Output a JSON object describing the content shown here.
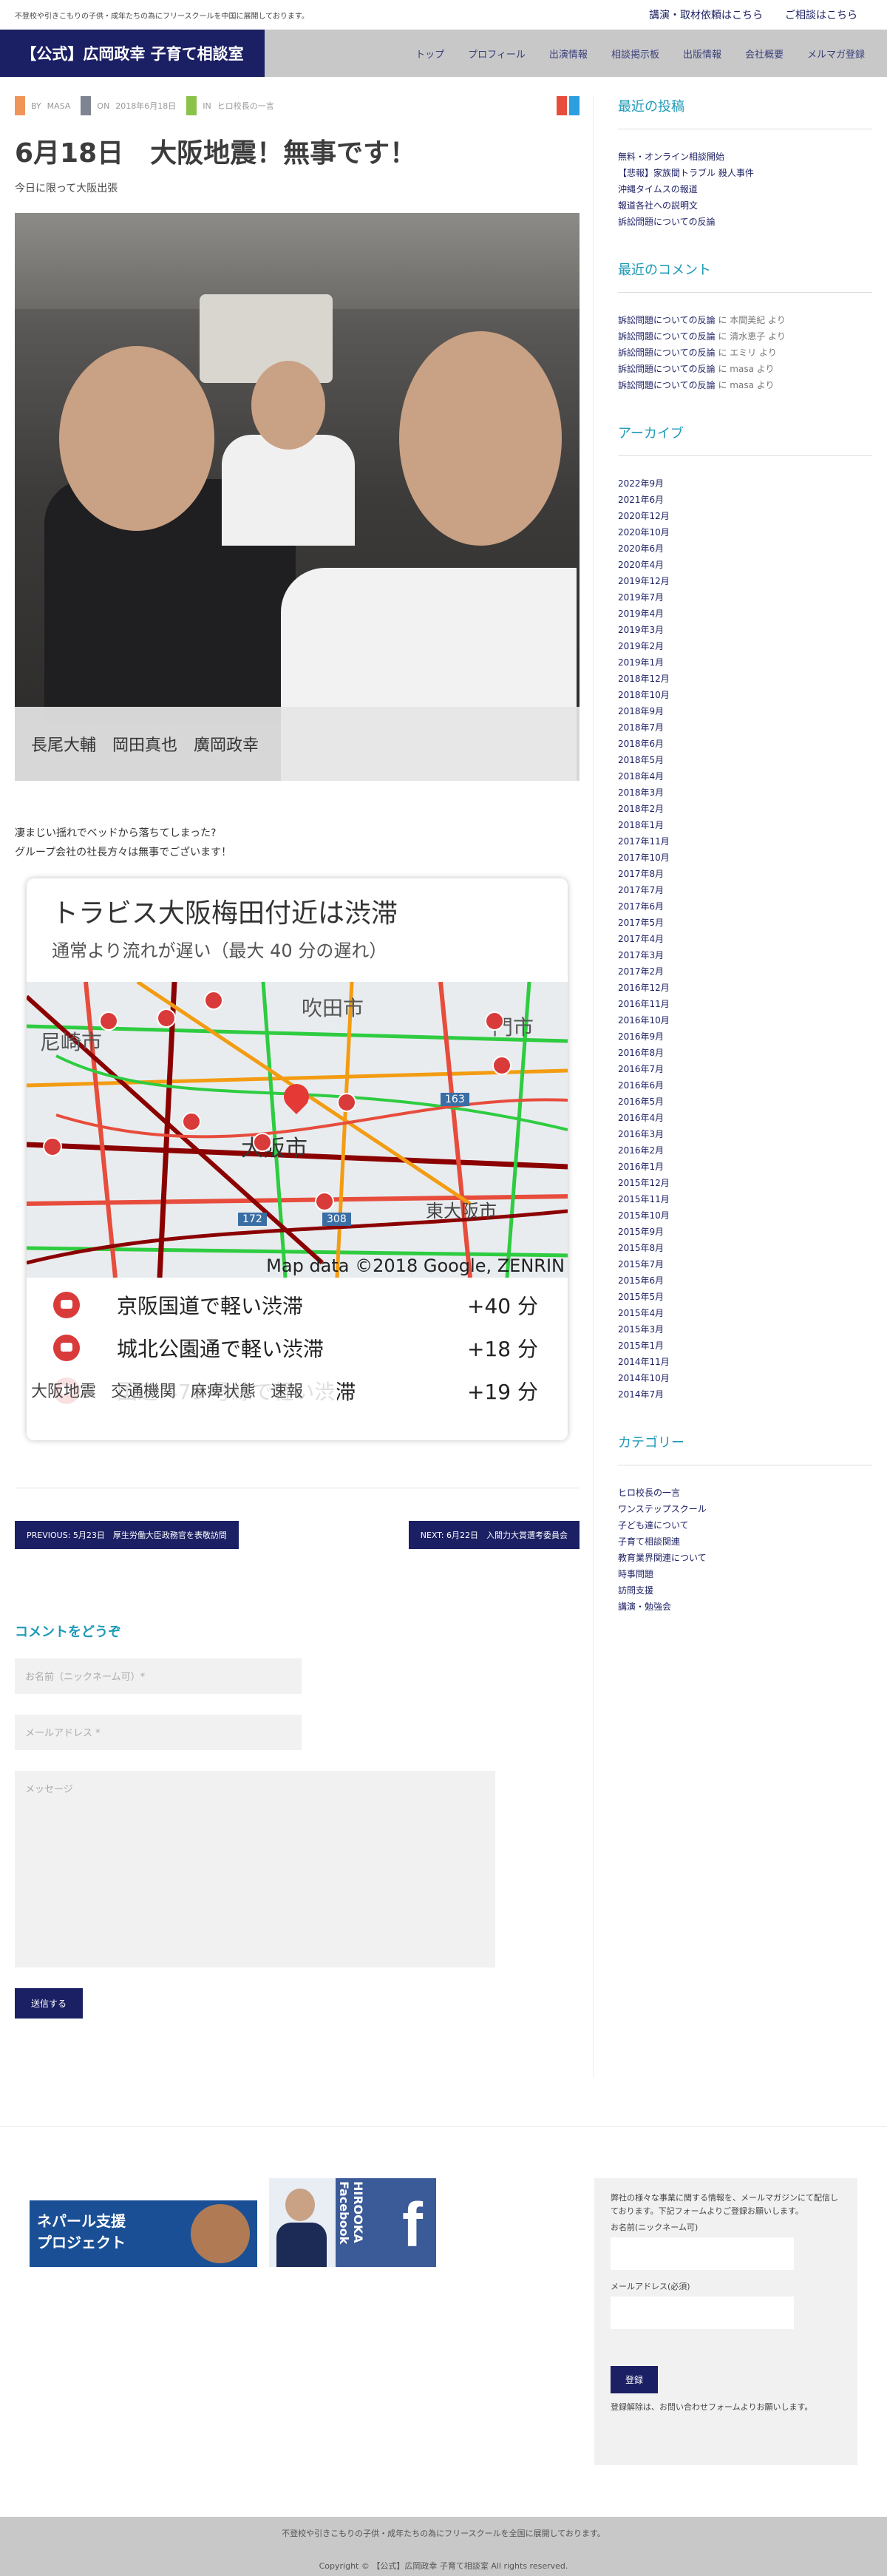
{
  "topbar": {
    "tagline": "不登校や引きこもりの子供・成年たちの為にフリースクールを中国に展開しております。",
    "link1": "講演・取材依頼はこちら",
    "link2": "ご相談はこちら"
  },
  "header": {
    "logo": "【公式】広岡政幸 子育て相談室",
    "nav": [
      "トップ",
      "プロフィール",
      "出演情報",
      "相談掲示板",
      "出版情報",
      "会社概要",
      "メルマガ登録"
    ]
  },
  "post": {
    "by": "BY",
    "author": "MASA",
    "on": "ON",
    "date": "2018年6月18日",
    "in": "IN",
    "category": "ヒロ校長の一言",
    "title": "6月18日　大阪地震！無事です！",
    "subtitle": "今日に限って大阪出張",
    "photo_caption": "長尾大輔　岡田真也　廣岡政幸",
    "body_line1": "凄まじい揺れでベッドから落ちてしまった?",
    "body_line2": "グループ会社の社長方々は無事でございます！",
    "traffic": {
      "title": "トラビス大阪梅田付近は渋滞",
      "subtitle": "通常より流れが遅い（最大 40 分の遅れ）",
      "map_attribution": "Map data ©2018 Google, ZENRIN",
      "places": [
        "尼崎市",
        "吹田市",
        "門市",
        "大阪市",
        "東大阪市"
      ],
      "road_numbers": [
        "163",
        "172",
        "308"
      ],
      "routes": [
        {
          "name": "京阪国道で軽い渋滞",
          "delay": "+40 分"
        },
        {
          "name": "城北公園通で軽い渋滞",
          "delay": "+18 分"
        },
        {
          "name": "国道 479 号線で軽い渋滞",
          "delay": "+19 分"
        }
      ],
      "tags": [
        "大阪地震",
        "交通機関",
        "麻痺状態",
        "速報"
      ]
    },
    "prev": "PREVIOUS: 5月23日　厚生労働大臣政務官を表敬訪問",
    "next": "NEXT: 6月22日　入間力大賞選考委員会"
  },
  "comment_form": {
    "heading": "コメントをどうぞ",
    "name_placeholder": "お名前（ニックネーム可）*",
    "email_placeholder": "メールアドレス *",
    "message_placeholder": "メッセージ",
    "submit": "送信する"
  },
  "sidebar": {
    "recent_posts_title": "最近の投稿",
    "recent_posts": [
      "無料・オンライン相談開始",
      "【悲報】家族間トラブル 殺人事件",
      "沖縄タイムスの報道",
      "報道各社への説明文",
      "訴訟問題についての反論"
    ],
    "recent_comments_title": "最近のコメント",
    "recent_comments": [
      {
        "post": "訴訟問題についての反論",
        "by": "に 本間美紀 より"
      },
      {
        "post": "訴訟問題についての反論",
        "by": "に 清水恵子 より"
      },
      {
        "post": "訴訟問題についての反論",
        "by": "に エミリ より"
      },
      {
        "post": "訴訟問題についての反論",
        "by": "に masa より"
      },
      {
        "post": "訴訟問題についての反論",
        "by": "に masa より"
      }
    ],
    "archives_title": "アーカイブ",
    "archives": [
      "2022年9月",
      "2021年6月",
      "2020年12月",
      "2020年10月",
      "2020年6月",
      "2020年4月",
      "2019年12月",
      "2019年7月",
      "2019年4月",
      "2019年3月",
      "2019年2月",
      "2019年1月",
      "2018年12月",
      "2018年10月",
      "2018年9月",
      "2018年7月",
      "2018年6月",
      "2018年5月",
      "2018年4月",
      "2018年3月",
      "2018年2月",
      "2018年1月",
      "2017年11月",
      "2017年10月",
      "2017年8月",
      "2017年7月",
      "2017年6月",
      "2017年5月",
      "2017年4月",
      "2017年3月",
      "2017年2月",
      "2016年12月",
      "2016年11月",
      "2016年10月",
      "2016年9月",
      "2016年8月",
      "2016年7月",
      "2016年6月",
      "2016年5月",
      "2016年4月",
      "2016年3月",
      "2016年2月",
      "2016年1月",
      "2015年12月",
      "2015年11月",
      "2015年10月",
      "2015年9月",
      "2015年8月",
      "2015年7月",
      "2015年6月",
      "2015年5月",
      "2015年4月",
      "2015年3月",
      "2015年1月",
      "2014年11月",
      "2014年10月",
      "2014年7月"
    ],
    "categories_title": "カテゴリー",
    "categories": [
      "ヒロ校長の一言",
      "ワンステップスクール",
      "子ども達について",
      "子育て相談関連",
      "教育業界関連について",
      "時事問題",
      "訪問支援",
      "講演・勉強会"
    ]
  },
  "footer": {
    "banner1": "ネパール支援\nプロジェクト",
    "banner2_name": "HIROOKA\nFacebook",
    "banner2_letter": "f",
    "newsletter_desc": "弊社の様々な事業に関する情報を、メールマガジンにて配信しております。下記フォームよりご登録お願いします。",
    "newsletter_name_label": "お名前(ニックネーム可)",
    "newsletter_email_label": "メールアドレス(必須)",
    "newsletter_button": "登録",
    "newsletter_note": "登録解除は、お問い合わせフォームよりお願いします。",
    "tagline": "不登校や引きこもりの子供・成年たちの為にフリースクールを全国に展開しております。",
    "copyright": "Copyright ©  【公式】広岡政幸 子育て相談室 All rights reserved."
  },
  "colors": {
    "brand": "#1b1f63",
    "accent": "#1d9ab8",
    "header_bg": "#c8c8c8",
    "meta_orange": "#f0955a",
    "meta_gray": "#7d8590",
    "meta_green": "#8bc34a",
    "share_red": "#e74c3c",
    "share_blue": "#2d9ee0"
  }
}
